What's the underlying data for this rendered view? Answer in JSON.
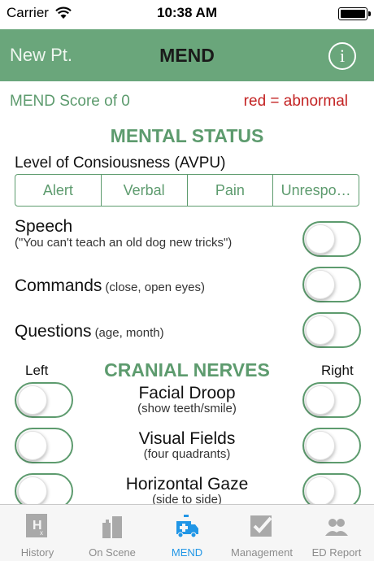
{
  "status_bar": {
    "carrier": "Carrier",
    "time": "10:38 AM"
  },
  "nav": {
    "left": "New Pt.",
    "title": "MEND",
    "info_label": "i"
  },
  "score_text": "MEND Score of 0",
  "legend_text": "red = abnormal",
  "mental_status": {
    "title": "MENTAL STATUS",
    "loc_label": "Level of Consiousness (AVPU)",
    "segments": [
      "Alert",
      "Verbal",
      "Pain",
      "Unrespo…"
    ],
    "items": [
      {
        "label": "Speech",
        "sub": "(\"You can't teach an old dog new tricks\")"
      },
      {
        "label": "Commands",
        "sub": "(close, open eyes)"
      },
      {
        "label": "Questions",
        "sub": "(age, month)"
      }
    ]
  },
  "cranial_nerves": {
    "title": "CRANIAL NERVES",
    "left_label": "Left",
    "right_label": "Right",
    "items": [
      {
        "label": "Facial Droop",
        "sub": "(show teeth/smile)"
      },
      {
        "label": "Visual Fields",
        "sub": "(four quadrants)"
      },
      {
        "label": "Horizontal Gaze",
        "sub": "(side to side)"
      }
    ]
  },
  "tabs": [
    {
      "label": "History",
      "icon": "history-icon"
    },
    {
      "label": "On Scene",
      "icon": "buildings-icon"
    },
    {
      "label": "MEND",
      "icon": "ambulance-icon"
    },
    {
      "label": "Management",
      "icon": "checkbox-icon"
    },
    {
      "label": "ED Report",
      "icon": "people-icon"
    }
  ],
  "colors": {
    "nav": "#6aa67b",
    "accent_green": "#5d9b6e",
    "abnormal_red": "#c32323",
    "tab_active": "#2196e6"
  }
}
